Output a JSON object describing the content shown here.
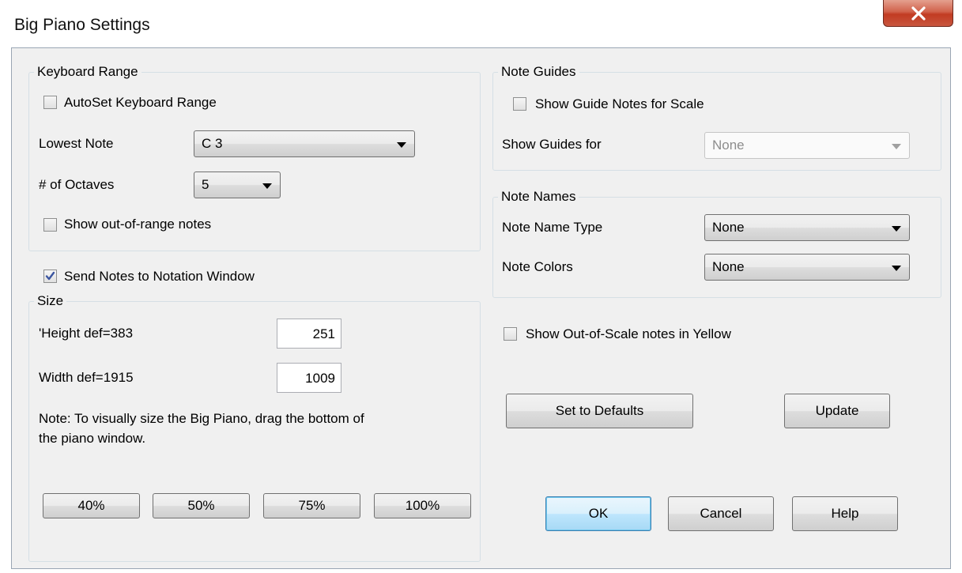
{
  "window": {
    "title": "Big Piano Settings",
    "close_icon": "close-icon"
  },
  "keyboard_range": {
    "group_label": "Keyboard Range",
    "autoset_label": "AutoSet Keyboard Range",
    "autoset_checked": false,
    "lowest_note_label": "Lowest Note",
    "lowest_note_value": "C 3",
    "octaves_label": "# of Octaves",
    "octaves_value": "5",
    "show_out_of_range_label": "Show out-of-range notes",
    "show_out_of_range_checked": false
  },
  "send_notes": {
    "label": "Send Notes to Notation Window",
    "checked": true
  },
  "size": {
    "group_label": "Size",
    "height_label": "'Height def=383",
    "height_value": "251",
    "width_label": "Width def=1915",
    "width_value": "1009",
    "note_line1": "Note: To visually size the Big Piano, drag the bottom of",
    "note_line2": "the piano window.",
    "preset_buttons": [
      "40%",
      "50%",
      "75%",
      "100%"
    ]
  },
  "note_guides": {
    "group_label": "Note Guides",
    "show_guide_label": "Show Guide Notes for Scale",
    "show_guide_checked": false,
    "show_guides_for_label": "Show Guides for",
    "show_guides_for_value": "None",
    "show_guides_for_disabled": true
  },
  "note_names": {
    "group_label": "Note Names",
    "name_type_label": "Note Name Type",
    "name_type_value": "None",
    "colors_label": "Note Colors",
    "colors_value": "None"
  },
  "out_of_scale": {
    "label": "Show Out-of-Scale notes in Yellow",
    "checked": false
  },
  "buttons": {
    "set_defaults": "Set to Defaults",
    "update": "Update",
    "ok": "OK",
    "cancel": "Cancel",
    "help": "Help"
  },
  "colors": {
    "check_mark": "#3b55a0",
    "close_button": "#c23b22",
    "default_button_border": "#3c7fb1"
  }
}
